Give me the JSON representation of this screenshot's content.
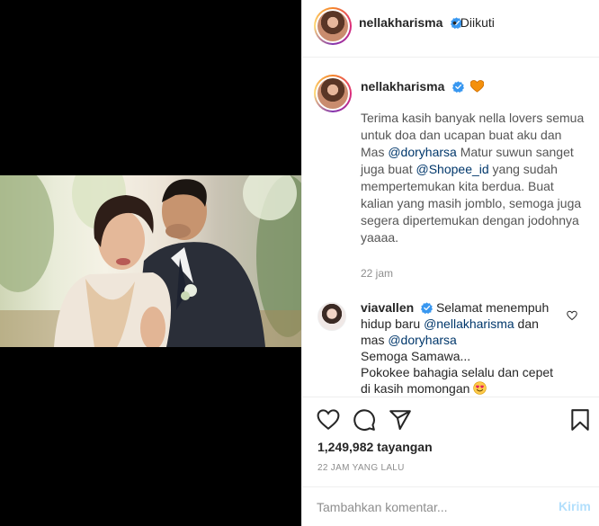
{
  "post": {
    "username": "nellakharisma",
    "dot": "•",
    "follow_status": "Diikuti"
  },
  "caption": {
    "username": "nellakharisma",
    "text_1": "Terima kasih banyak nella lovers semua untuk doa dan ucapan buat aku dan Mas ",
    "mention_1": "@doryharsa",
    "text_2": " Matur suwun sanget juga buat ",
    "mention_2": "@Shopee_id",
    "text_3": " yang sudah mempertemukan kita berdua. Buat kalian yang masih jomblo, semoga juga segera dipertemukan dengan jodohnya yaaaa.",
    "time": "22 jam"
  },
  "comment": {
    "username": "viavallen",
    "text_1": "Selamat menempuh hidup baru ",
    "mention_1": "@nellakharisma",
    "text_2": " dan mas ",
    "mention_2": "@doryharsa",
    "text_3": "Semoga Samawa...",
    "text_4": "Pokokee bahagia selalu dan cepet di kasih momongan "
  },
  "stats": {
    "views": "1,249,982 tayangan",
    "time_ago": "22 JAM YANG LALU"
  },
  "add_comment": {
    "placeholder": "Tambahkan komentar...",
    "post_label": "Kirim"
  },
  "icons": [
    "verified-badge-icon",
    "orange-heart-emoji-icon",
    "heart-icon",
    "comment-icon",
    "share-icon",
    "bookmark-icon",
    "heart-eyes-emoji-icon"
  ],
  "colors": {
    "link": "#00376b",
    "verified": "#3897f0",
    "post_disabled": "#b2dffc",
    "secondary_text": "#8e8e8e"
  }
}
